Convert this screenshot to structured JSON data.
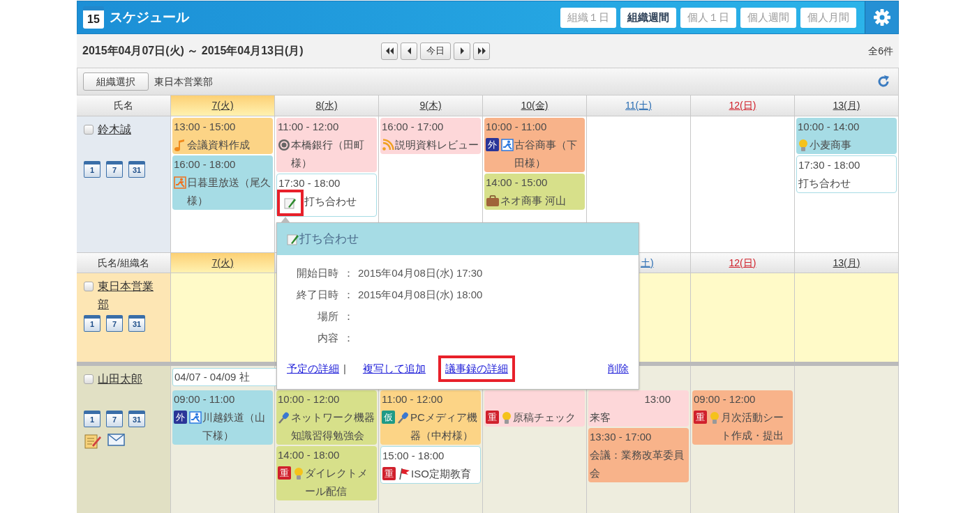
{
  "header": {
    "logo_day": "15",
    "title": "スケジュール",
    "views": [
      {
        "label": "組織１日",
        "selected": false
      },
      {
        "label": "組織週間",
        "selected": true
      },
      {
        "label": "個人１日",
        "selected": false
      },
      {
        "label": "個人週間",
        "selected": false
      },
      {
        "label": "個人月間",
        "selected": false
      }
    ]
  },
  "toolbar": {
    "date_range": "2015年04月07日(火) ～ 2015年04月13日(月)",
    "nav": [
      {
        "kind": "first"
      },
      {
        "kind": "prev"
      },
      {
        "kind": "today",
        "label": "今日"
      },
      {
        "kind": "next"
      },
      {
        "kind": "last"
      }
    ],
    "count": "全6件"
  },
  "org_bar": {
    "button": "組織選択",
    "org_name": "東日本営業部"
  },
  "section1": {
    "name_header": "氏名",
    "days": [
      {
        "label": "7(火)",
        "color": "#333333",
        "today": true
      },
      {
        "label": "8(水)",
        "color": "#333333",
        "today": false
      },
      {
        "label": "9(木)",
        "color": "#333333",
        "today": false
      },
      {
        "label": "10(金)",
        "color": "#333333",
        "today": false
      },
      {
        "label": "11(土)",
        "color": "#2a6db3",
        "today": false
      },
      {
        "label": "12(日)",
        "color": "#d0202a",
        "today": false
      },
      {
        "label": "13(月)",
        "color": "#333333",
        "today": false
      }
    ],
    "rows": [
      {
        "name": "鈴木誠",
        "kind": "person",
        "checked": false,
        "view_icons": [
          "1",
          "7",
          "31"
        ],
        "extra_icons": [],
        "cells": [
          [
            {
              "time": "13:00 - 15:00",
              "title": "会議資料作成",
              "color": "#fcd486",
              "kind": "note"
            },
            {
              "time": "16:00 - 18:00",
              "title": "日暮里放送（尾久様）",
              "color": "#a6dce5",
              "kind": "runner"
            }
          ],
          [
            {
              "time": "11:00 - 12:00",
              "title": "本橋銀行（田町様）",
              "color": "#fdd7d9",
              "kind": "target"
            },
            {
              "time": "17:30 - 18:00",
              "title": "打ち合わせ",
              "color": "#ffffff",
              "kind": "memo",
              "highlighted": true
            }
          ],
          [
            {
              "time": "16:00 - 17:00",
              "title": "説明資料レビュー",
              "color": "#fdd7d9",
              "kind": "feed"
            }
          ],
          [
            {
              "time": "10:00 - 11:00",
              "title": "古谷商事（下田様）",
              "color": "#f8b38a",
              "badges": [
                {
                  "text": "外",
                  "color": "#2a3598"
                }
              ],
              "kind": "runner-blue"
            },
            {
              "time": "14:00 - 15:00",
              "title": "ネオ商事 河山",
              "color": "#d7e08a",
              "kind": "briefcase"
            }
          ],
          [],
          [],
          [
            {
              "time": "10:00 - 14:00",
              "title": "小麦商事",
              "color": "#a6dce5",
              "kind": "bulb"
            },
            {
              "time": "17:30 - 18:00",
              "title": "打ち合わせ",
              "color": "#ffffff",
              "kind": "plain"
            }
          ]
        ]
      }
    ]
  },
  "section2": {
    "name_header": "氏名/組織名",
    "days": [
      {
        "label": "7(火)",
        "color": "#333333"
      },
      {
        "label": "土)",
        "color": "#2a6db3",
        "covered": true
      },
      {
        "label": "12(日)",
        "color": "#d0202a"
      },
      {
        "label": "13(月)",
        "color": "#333333"
      }
    ],
    "rows": [
      {
        "name": "東日本営業部",
        "kind": "org",
        "checked": false,
        "view_icons": [
          "1",
          "7",
          "31"
        ],
        "extra_icons": [],
        "spans": [],
        "cells": [
          [],
          [],
          [],
          [],
          [],
          [],
          []
        ]
      },
      {
        "name": "山田太郎",
        "kind": "person",
        "checked": false,
        "view_icons": [
          "1",
          "7",
          "31"
        ],
        "extra_icons": [
          {
            "kind": "memo"
          },
          {
            "kind": "mail"
          }
        ],
        "spans": [
          {
            "text": "04/07 - 04/09 社"
          }
        ],
        "cells": [
          [
            {
              "time": "09:00 - 11:00",
              "title": "川越鉄道（山下様）",
              "color": "#a6dce5",
              "badges": [
                {
                  "text": "外",
                  "color": "#2a3598"
                }
              ],
              "kind": "runner-blue"
            }
          ],
          [
            {
              "time": "10:00 - 12:00",
              "title": "ネットワーク機器知識習得勉強会",
              "color": "#d7e08a",
              "kind": "mic"
            },
            {
              "time": "14:00 - 18:00",
              "title": "ダイレクトメール配信",
              "color": "#d7e08a",
              "badges": [
                {
                  "text": "重",
                  "color": "#d0202c"
                }
              ],
              "kind": "bulb"
            }
          ],
          [
            {
              "time": "11:00 - 12:00",
              "title": "PCメディア機器（中村様）",
              "color": "#fcd486",
              "badges": [
                {
                  "text": "仮",
                  "color": "#1f9a86"
                }
              ],
              "kind": "mic"
            },
            {
              "time": "15:00 - 18:00",
              "title": "ISO定期教育",
              "color": "#ffffff",
              "badges": [
                {
                  "text": "重",
                  "color": "#d0202c"
                }
              ],
              "kind": "flag"
            }
          ],
          [
            {
              "covered": true,
              "title": "原稿チェック",
              "color": "#fdd7d9",
              "badges": [
                {
                  "text": "重",
                  "color": "#d0202c"
                }
              ],
              "kind": "bulb"
            }
          ],
          [
            {
              "covered": true,
              "time": "13:00",
              "title": "来客",
              "color": "#fdd7d9",
              "kind": "plain"
            },
            {
              "time": "13:30 - 17:00",
              "title": "会議：業務改革委員会",
              "color": "#f8b38a",
              "kind": "plain"
            }
          ],
          [
            {
              "time": "09:00 - 12:00",
              "title": "月次活動シート作成・提出",
              "color": "#f8b38a",
              "badges": [
                {
                  "text": "重",
                  "color": "#d0202c"
                }
              ],
              "kind": "bulb"
            }
          ],
          []
        ]
      }
    ]
  },
  "popup": {
    "title": "打ち合わせ",
    "separator": "：",
    "fields": [
      {
        "label": "開始日時",
        "value": "2015年04月08日(水) 17:30"
      },
      {
        "label": "終了日時",
        "value": "2015年04月08日(水) 18:00"
      },
      {
        "label": "場所"
      },
      {
        "label": "内容"
      }
    ],
    "actions": [
      {
        "kind": "link",
        "text": "予定の詳細",
        "highlighted": false
      },
      {
        "kind": "divider",
        "text": "|"
      },
      {
        "kind": "link",
        "text": "複写して追加",
        "highlighted": false
      },
      {
        "kind": "link",
        "text": "議事録の詳細",
        "highlighted": true
      },
      {
        "kind": "trailing_link",
        "text": "削除",
        "highlighted": false
      }
    ]
  }
}
